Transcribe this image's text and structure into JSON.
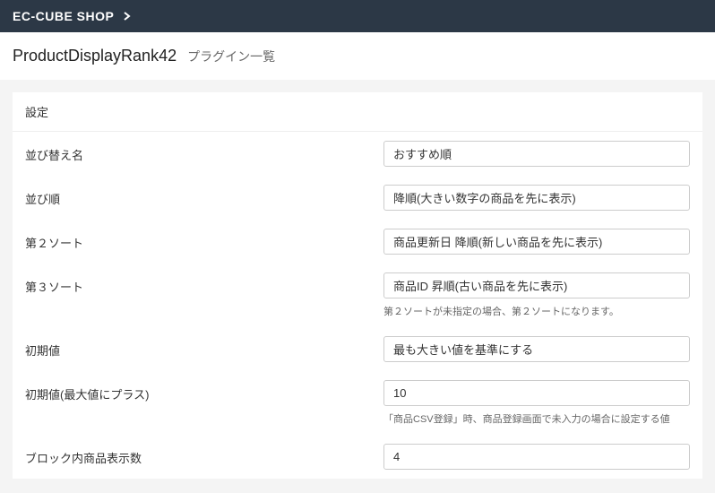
{
  "header": {
    "shop_name": "EC-CUBE SHOP"
  },
  "page": {
    "title": "ProductDisplayRank42",
    "subtitle": "プラグイン一覧"
  },
  "panel": {
    "heading": "設定"
  },
  "form": {
    "sort_name": {
      "label": "並び替え名",
      "value": "おすすめ順"
    },
    "sort_order": {
      "label": "並び順",
      "value": "降順(大きい数字の商品を先に表示)"
    },
    "second_sort": {
      "label": "第２ソート",
      "value": "商品更新日 降順(新しい商品を先に表示)"
    },
    "third_sort": {
      "label": "第３ソート",
      "value": "商品ID 昇順(古い商品を先に表示)",
      "help": "第２ソートが未指定の場合、第２ソートになります。"
    },
    "initial_value": {
      "label": "初期値",
      "value": "最も大きい値を基準にする"
    },
    "initial_plus": {
      "label": "初期値(最大値にプラス)",
      "value": "10",
      "help": "「商品CSV登録」時、商品登録画面で未入力の場合に設定する値"
    },
    "block_display_count": {
      "label": "ブロック内商品表示数",
      "value": "4"
    }
  }
}
